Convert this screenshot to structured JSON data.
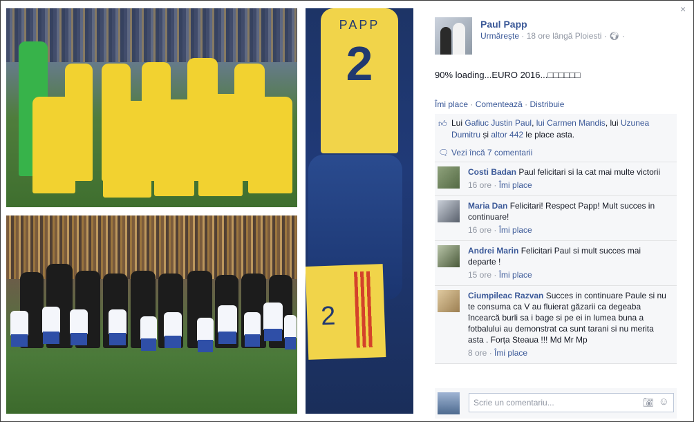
{
  "window": {
    "close_label": "×"
  },
  "post": {
    "author": "Paul Papp",
    "follow_label": "Urmărește",
    "time_location": "18 ore lângă Ploiesti",
    "privacy_icon": "globe-icon",
    "options_label": "·",
    "text": "90% loading...EURO 2016...□□□□□□",
    "shirt_name": "PAPP",
    "shirt_number": "2",
    "folded_number": "2",
    "actions": {
      "like": "Îmi place",
      "comment": "Comentează",
      "share": "Distribuie",
      "separator": "·"
    }
  },
  "likes": {
    "prefix": "Lui",
    "name1": "Gafiuc Justin Paul",
    "sep1": ",",
    "name2": "lui Carmen Mandis",
    "sep2": ",",
    "name3": "lui",
    "name3b": "Uzunea Dumitru",
    "and": "și",
    "others": "altor 442",
    "suffix": "le place asta."
  },
  "more_comments": "Vezi încă 7 comentarii",
  "comments": [
    {
      "author": "Costi Badan",
      "text": "Paul felicitari si la cat mai multe victorii",
      "time": "16 ore",
      "like_label": "Îmi place"
    },
    {
      "author": "Maria Dan",
      "text": "Felicitari! Respect Papp! Mult succes in continuare!",
      "time": "16 ore",
      "like_label": "Îmi place"
    },
    {
      "author": "Andrei Marin",
      "text": "Felicitari Paul si mult succes mai departe !",
      "time": "15 ore",
      "like_label": "Îmi place"
    },
    {
      "author": "Ciumpileac Razvan",
      "text": "Succes in continuare Paule si nu te consuma ca V au fluierat găzarii ca degeaba încearcă burli sa i bage si pe ei in lumea buna a fotbalului au demonstrat ca sunt tarani si nu merita asta . Forța Steaua !!! Md Mr Mp",
      "time": "8 ore",
      "like_label": "Îmi place"
    }
  ],
  "compose": {
    "placeholder": "Scrie un comentariu..."
  },
  "colors": {
    "link": "#3b5998",
    "muted": "#9197a3",
    "comment_bg": "#f6f7f9"
  }
}
